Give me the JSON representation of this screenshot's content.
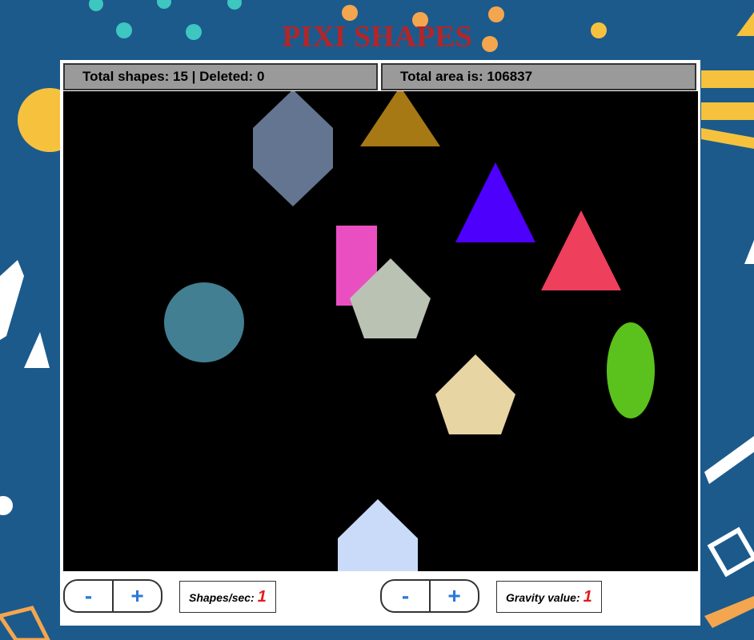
{
  "page": {
    "title": "PIXI SHAPES"
  },
  "stats": {
    "shapes_label": "Total shapes: 15 |  Deleted: 0",
    "area_label": "Total area is: 106837"
  },
  "controls": {
    "shapes_rate": {
      "minus": "-",
      "plus": "+",
      "label": "Shapes/sec:",
      "value": "1"
    },
    "gravity": {
      "minus": "-",
      "plus": "+",
      "label": "Gravity value:",
      "value": "1"
    }
  },
  "shapes": [
    {
      "kind": "hexagon",
      "color": "#637590"
    },
    {
      "kind": "triangle",
      "color": "#a67915"
    },
    {
      "kind": "triangle",
      "color": "#4d00fc"
    },
    {
      "kind": "triangle",
      "color": "#ee3f5d"
    },
    {
      "kind": "rectangle",
      "color": "#ea4fc2"
    },
    {
      "kind": "pentagon",
      "color": "#bac3b3"
    },
    {
      "kind": "circle",
      "color": "#427f92"
    },
    {
      "kind": "ellipse",
      "color": "#5bc11c"
    },
    {
      "kind": "pentagon",
      "color": "#e7d5a4"
    },
    {
      "kind": "house-pentagon",
      "color": "#c9dbf8"
    }
  ]
}
